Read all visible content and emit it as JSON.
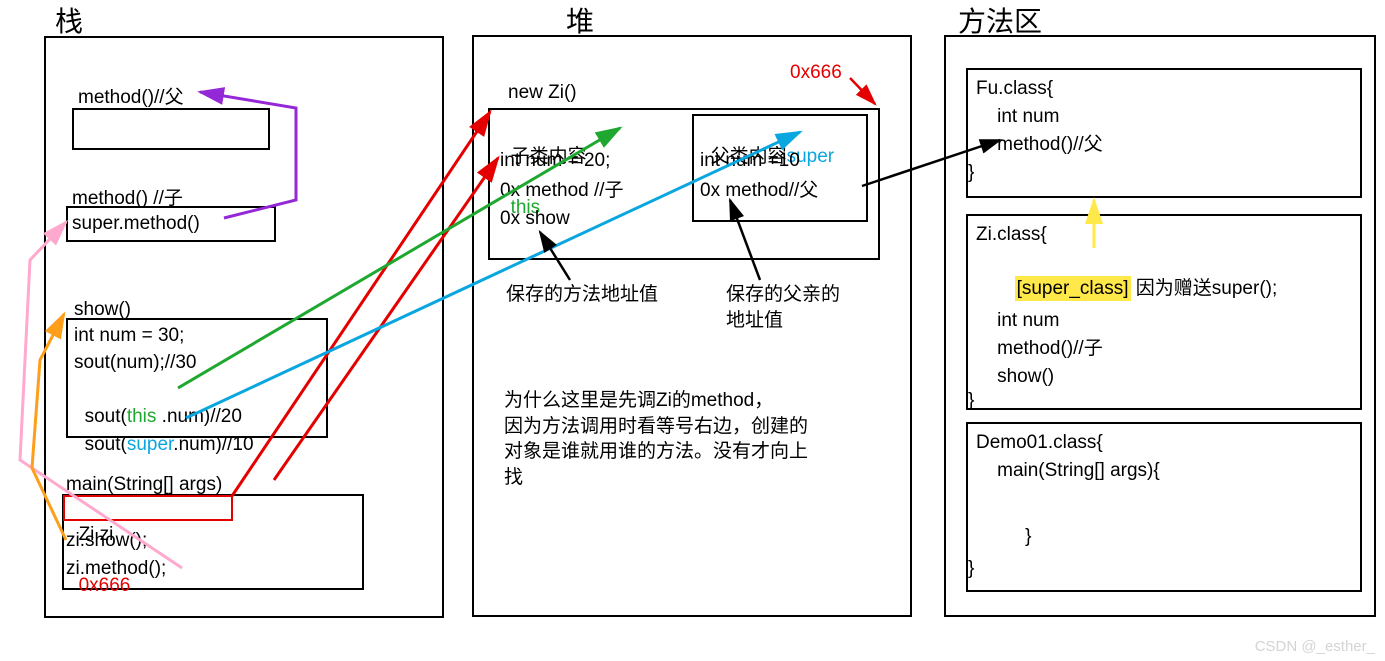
{
  "headers": {
    "stack": "栈",
    "heap": "堆",
    "method_area": "方法区"
  },
  "stack": {
    "frame1": "method()//父",
    "frame2_line1": "method() //子",
    "frame2_line2": "super.method()",
    "frame3_title": "show()",
    "frame3_l1": "int num = 30;",
    "frame3_l2": "sout(num);//30",
    "frame3_l3a": "sout(",
    "frame3_l3b": "this",
    "frame3_l3c": " .num)//20",
    "frame3_l4a": "sout(",
    "frame3_l4b": "super",
    "frame3_l4c": ".num)//10",
    "frame4_title": "main(String[] args)",
    "frame4_l1a": "Zi zi",
    "frame4_l1b": "0x666",
    "frame4_l2": "zi.show();",
    "frame4_l3": "zi.method();"
  },
  "heap": {
    "new_label": "new Zi()",
    "addr": "0x666",
    "child_title": "子类内容",
    "child_this": "this",
    "child_l1": "int num = 20;",
    "child_l2": "0x method //子",
    "child_l3": "0x show",
    "parent_title": "父类内容",
    "parent_super": "super",
    "parent_l1": "int num =10",
    "parent_l2": "0x method//父",
    "note_left": "保存的方法地址值",
    "note_right_1": "保存的父亲的",
    "note_right_2": "地址值",
    "explain": "为什么这里是先调Zi的method，\n因为方法调用时看等号右边，创建的\n对象是谁就用谁的方法。没有才向上\n找"
  },
  "method_area": {
    "fu_l1": "Fu.class{",
    "fu_l2": "    int num",
    "fu_l3": "    method()//父",
    "fu_l4": "}",
    "zi_l1": "Zi.class{",
    "zi_super": "[super_class]",
    "zi_super_after": " 因为赠送super();",
    "zi_l3": "    int num",
    "zi_l4": "    method()//子",
    "zi_l5": "    show()",
    "zi_l6": "}",
    "demo_l1": "Demo01.class{",
    "demo_l2": "    main(String[] args){",
    "demo_l3": "    }",
    "demo_l4": "}"
  },
  "watermark": "CSDN @_esther_"
}
